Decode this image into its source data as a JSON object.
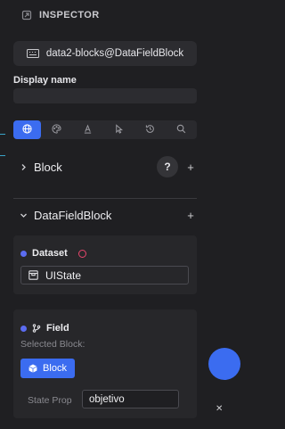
{
  "header": {
    "title": "INSPECTOR",
    "icon": "panel-icon"
  },
  "component": {
    "name": "data2-blocks@DataFieldBlock",
    "icon": "keyboard-icon"
  },
  "display_name": {
    "label": "Display name",
    "value": "",
    "placeholder": ""
  },
  "tabs": [
    {
      "icon": "globe-icon",
      "active": true
    },
    {
      "icon": "palette-icon",
      "active": false
    },
    {
      "icon": "text-icon",
      "active": false
    },
    {
      "icon": "pointer-icon",
      "active": false
    },
    {
      "icon": "history-icon",
      "active": false
    },
    {
      "icon": "search-icon",
      "active": false
    }
  ],
  "sections": {
    "block": {
      "title": "Block",
      "expanded": false,
      "help": "?",
      "add": "+"
    },
    "datafieldblock": {
      "title": "DataFieldBlock",
      "expanded": true,
      "add": "+"
    }
  },
  "dataset": {
    "title": "Dataset",
    "value": "UIState"
  },
  "field": {
    "title": "Field",
    "selected_label": "Selected Block:",
    "block_button": "Block",
    "state_prop_label": "State Prop",
    "state_prop_value": "objetivo"
  },
  "colors": {
    "accent": "#3b6cf0",
    "background": "#1f1f22",
    "status_ring": "#e8466c"
  }
}
